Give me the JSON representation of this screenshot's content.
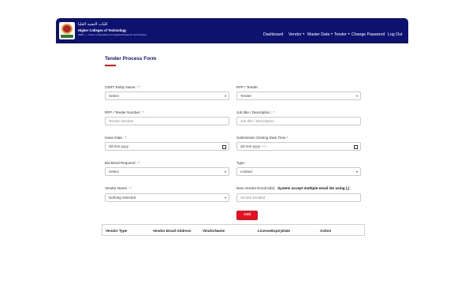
{
  "brand": {
    "name_ar": "كليات التقنية العليا",
    "name_en": "Higher Colleges of Technology",
    "tagline": "CERT — Centre of Excellence for Applied Research and Training"
  },
  "nav": {
    "items": [
      {
        "label": "Dashboard",
        "has_dropdown": false
      },
      {
        "label": "Vendor",
        "has_dropdown": true
      },
      {
        "label": "Master Data",
        "has_dropdown": true
      },
      {
        "label": "Tender",
        "has_dropdown": true
      },
      {
        "label": "Change Password",
        "has_dropdown": false
      },
      {
        "label": "Log Out",
        "has_dropdown": false
      }
    ],
    "caret": "▼"
  },
  "form": {
    "title": "Tender Process Form",
    "fields": {
      "cert_entity": {
        "label": "CERT Entity Name :",
        "required": "*",
        "value": "Select"
      },
      "rfp_tender": {
        "label": "RFP / Tender",
        "value": "Tender"
      },
      "rfp_number": {
        "label": "RFP / Tender Number :",
        "required": "*",
        "placeholder": "Tender Number"
      },
      "job_title": {
        "label": "Job title / Description :",
        "required": "*",
        "placeholder": "Job title / Description"
      },
      "issue_date": {
        "label": "Issue Date :",
        "required": "*",
        "value": "dd-mm-yyyy"
      },
      "closing_date": {
        "label": "Submission Closing Date Time",
        "required": "*",
        "value": "dd-mm-yyyy --:--"
      },
      "bid_bond": {
        "label": "Bid Bond Required :",
        "required": "*",
        "value": "Select"
      },
      "type": {
        "label": "Type :",
        "value": "Limited"
      },
      "vendor_name": {
        "label": "Vendor Name :",
        "required": "*",
        "value": "Nothing selected"
      },
      "vendor_email": {
        "label": "New Vendor Email Id(s):",
        "note": "System accept multiple email ids using (,)",
        "placeholder": "Vendor EmailId"
      }
    },
    "add_button": "Add"
  },
  "table": {
    "columns": [
      "Vendor Type",
      "Vendor Email Address",
      "VendorName",
      "LicenseExpiryDate",
      "Action"
    ]
  },
  "colors": {
    "navbar": "#0d1170",
    "title": "#0d1170",
    "accent_red": "#e8101e"
  },
  "icons": {
    "select_arrow": "chevron-down-icon",
    "date": "calendar-icon"
  }
}
